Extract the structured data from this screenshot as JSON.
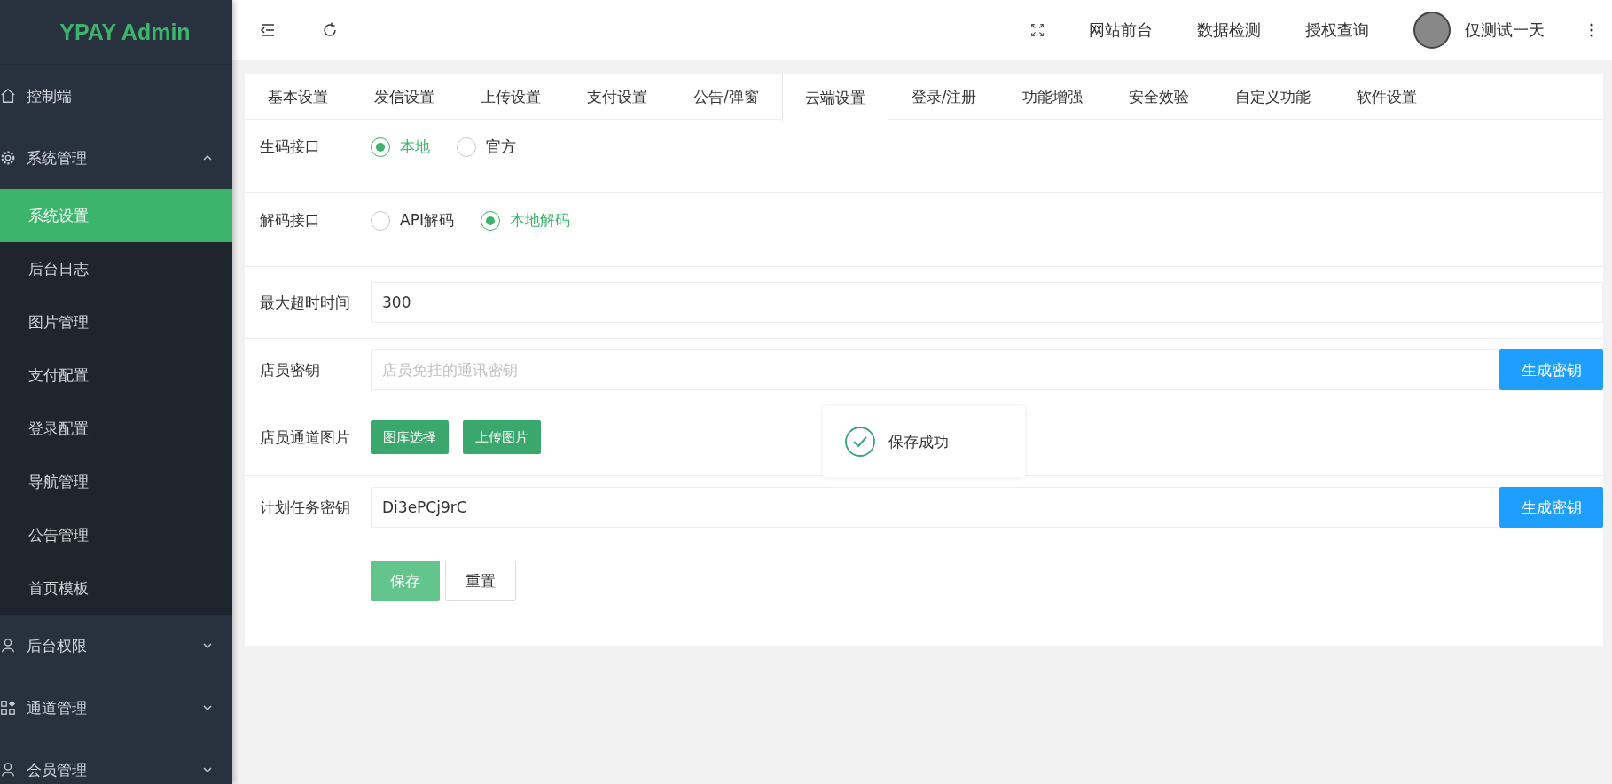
{
  "brand": "YPAY Admin",
  "sidebar": {
    "items": [
      {
        "label": "控制端",
        "kind": "home"
      },
      {
        "label": "系统管理",
        "kind": "gear",
        "expanded": true,
        "children": [
          {
            "label": "系统设置",
            "selected": true
          },
          {
            "label": "后台日志",
            "selected": false
          },
          {
            "label": "图片管理",
            "selected": false
          },
          {
            "label": "支付配置",
            "selected": false
          },
          {
            "label": "登录配置",
            "selected": false
          },
          {
            "label": "导航管理",
            "selected": false
          },
          {
            "label": "公告管理",
            "selected": false
          },
          {
            "label": "首页模板",
            "selected": false
          }
        ]
      },
      {
        "label": "后台权限",
        "kind": "user",
        "expanded": false
      },
      {
        "label": "通道管理",
        "kind": "grid",
        "expanded": false
      },
      {
        "label": "会员管理",
        "kind": "user",
        "expanded": false
      }
    ]
  },
  "header": {
    "links": [
      "网站前台",
      "数据检测",
      "授权查询"
    ],
    "user": "仅测试一天"
  },
  "tabs": [
    {
      "label": "基本设置",
      "selected": false
    },
    {
      "label": "发信设置",
      "selected": false
    },
    {
      "label": "上传设置",
      "selected": false
    },
    {
      "label": "支付设置",
      "selected": false
    },
    {
      "label": "公告/弹窗",
      "selected": false
    },
    {
      "label": "云端设置",
      "selected": true
    },
    {
      "label": "登录/注册",
      "selected": false
    },
    {
      "label": "功能增强",
      "selected": false
    },
    {
      "label": "安全效验",
      "selected": false
    },
    {
      "label": "自定义功能",
      "selected": false
    },
    {
      "label": "软件设置",
      "selected": false
    }
  ],
  "form": {
    "rows": [
      {
        "kind": "radio",
        "label": "生码接口",
        "options": [
          {
            "label": "本地",
            "selected": true
          },
          {
            "label": "官方",
            "selected": false
          }
        ]
      },
      {
        "kind": "radio",
        "label": "解码接口",
        "options": [
          {
            "label": "API解码",
            "selected": false
          },
          {
            "label": "本地解码",
            "selected": true
          }
        ]
      },
      {
        "kind": "input",
        "label": "最大超时时间",
        "value": "300"
      },
      {
        "kind": "input",
        "label": "店员密钥",
        "placeholder": "店员免挂的通讯密钥",
        "button": "生成密钥"
      },
      {
        "kind": "buttons",
        "label": "店员通道图片",
        "buttons": [
          "图库选择",
          "上传图片"
        ]
      },
      {
        "kind": "input",
        "label": "计划任务密钥",
        "value": "Di3ePCj9rC",
        "button": "生成密钥"
      }
    ],
    "actions": [
      {
        "label": "保存",
        "kind": "primary"
      },
      {
        "label": "重置",
        "kind": "default"
      }
    ]
  },
  "toast": {
    "message": "保存成功"
  }
}
